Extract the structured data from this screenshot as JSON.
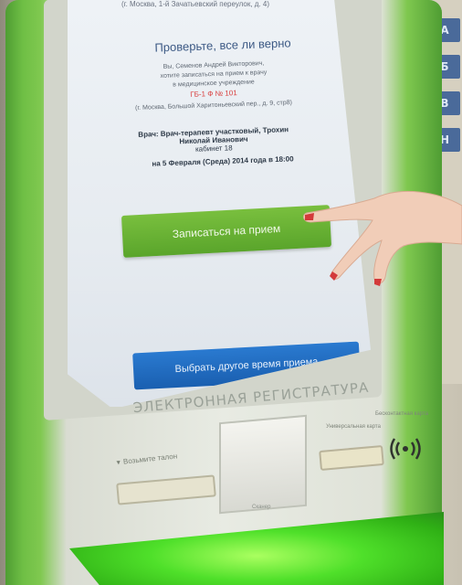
{
  "screen": {
    "address_top": "(г. Москва, 1-й Зачатьевский переулок, д. 4)",
    "title": "Проверьте, все ли верно",
    "line1": "Вы, Семенов Андрей Викторович,",
    "line2": "хотите записаться на прием к врачу",
    "line3": "в медицинское учреждение",
    "date_code": "ГБ-1 Ф № 101",
    "address": "(г. Москва, Большой Харитоньевский пер., д. 9, стр8)",
    "doctor": "Врач: Врач-терапевт участковый, Трохин Николай Иванович",
    "room": "кабинет 18",
    "when": "на 5 Февраля (Среда) 2014 года в 18:00",
    "signup_button": "Записаться на прием",
    "other_time_button": "Выбрать другое время приема"
  },
  "kiosk": {
    "brand": "ЭЛЕКТРОННАЯ РЕГИСТРАТУРА",
    "queue_label": "Возьмите талон",
    "card_label": "Универсальная карта",
    "contactless_label": "Бесконтактная карта",
    "slot_sub": "Сканер",
    "contactless_icon": "contactless-icon"
  },
  "colors": {
    "kiosk_green": "#6fbf45",
    "signup_green": "#5aa52b",
    "other_blue": "#1a5fb0",
    "glow": "#4fe02a"
  }
}
